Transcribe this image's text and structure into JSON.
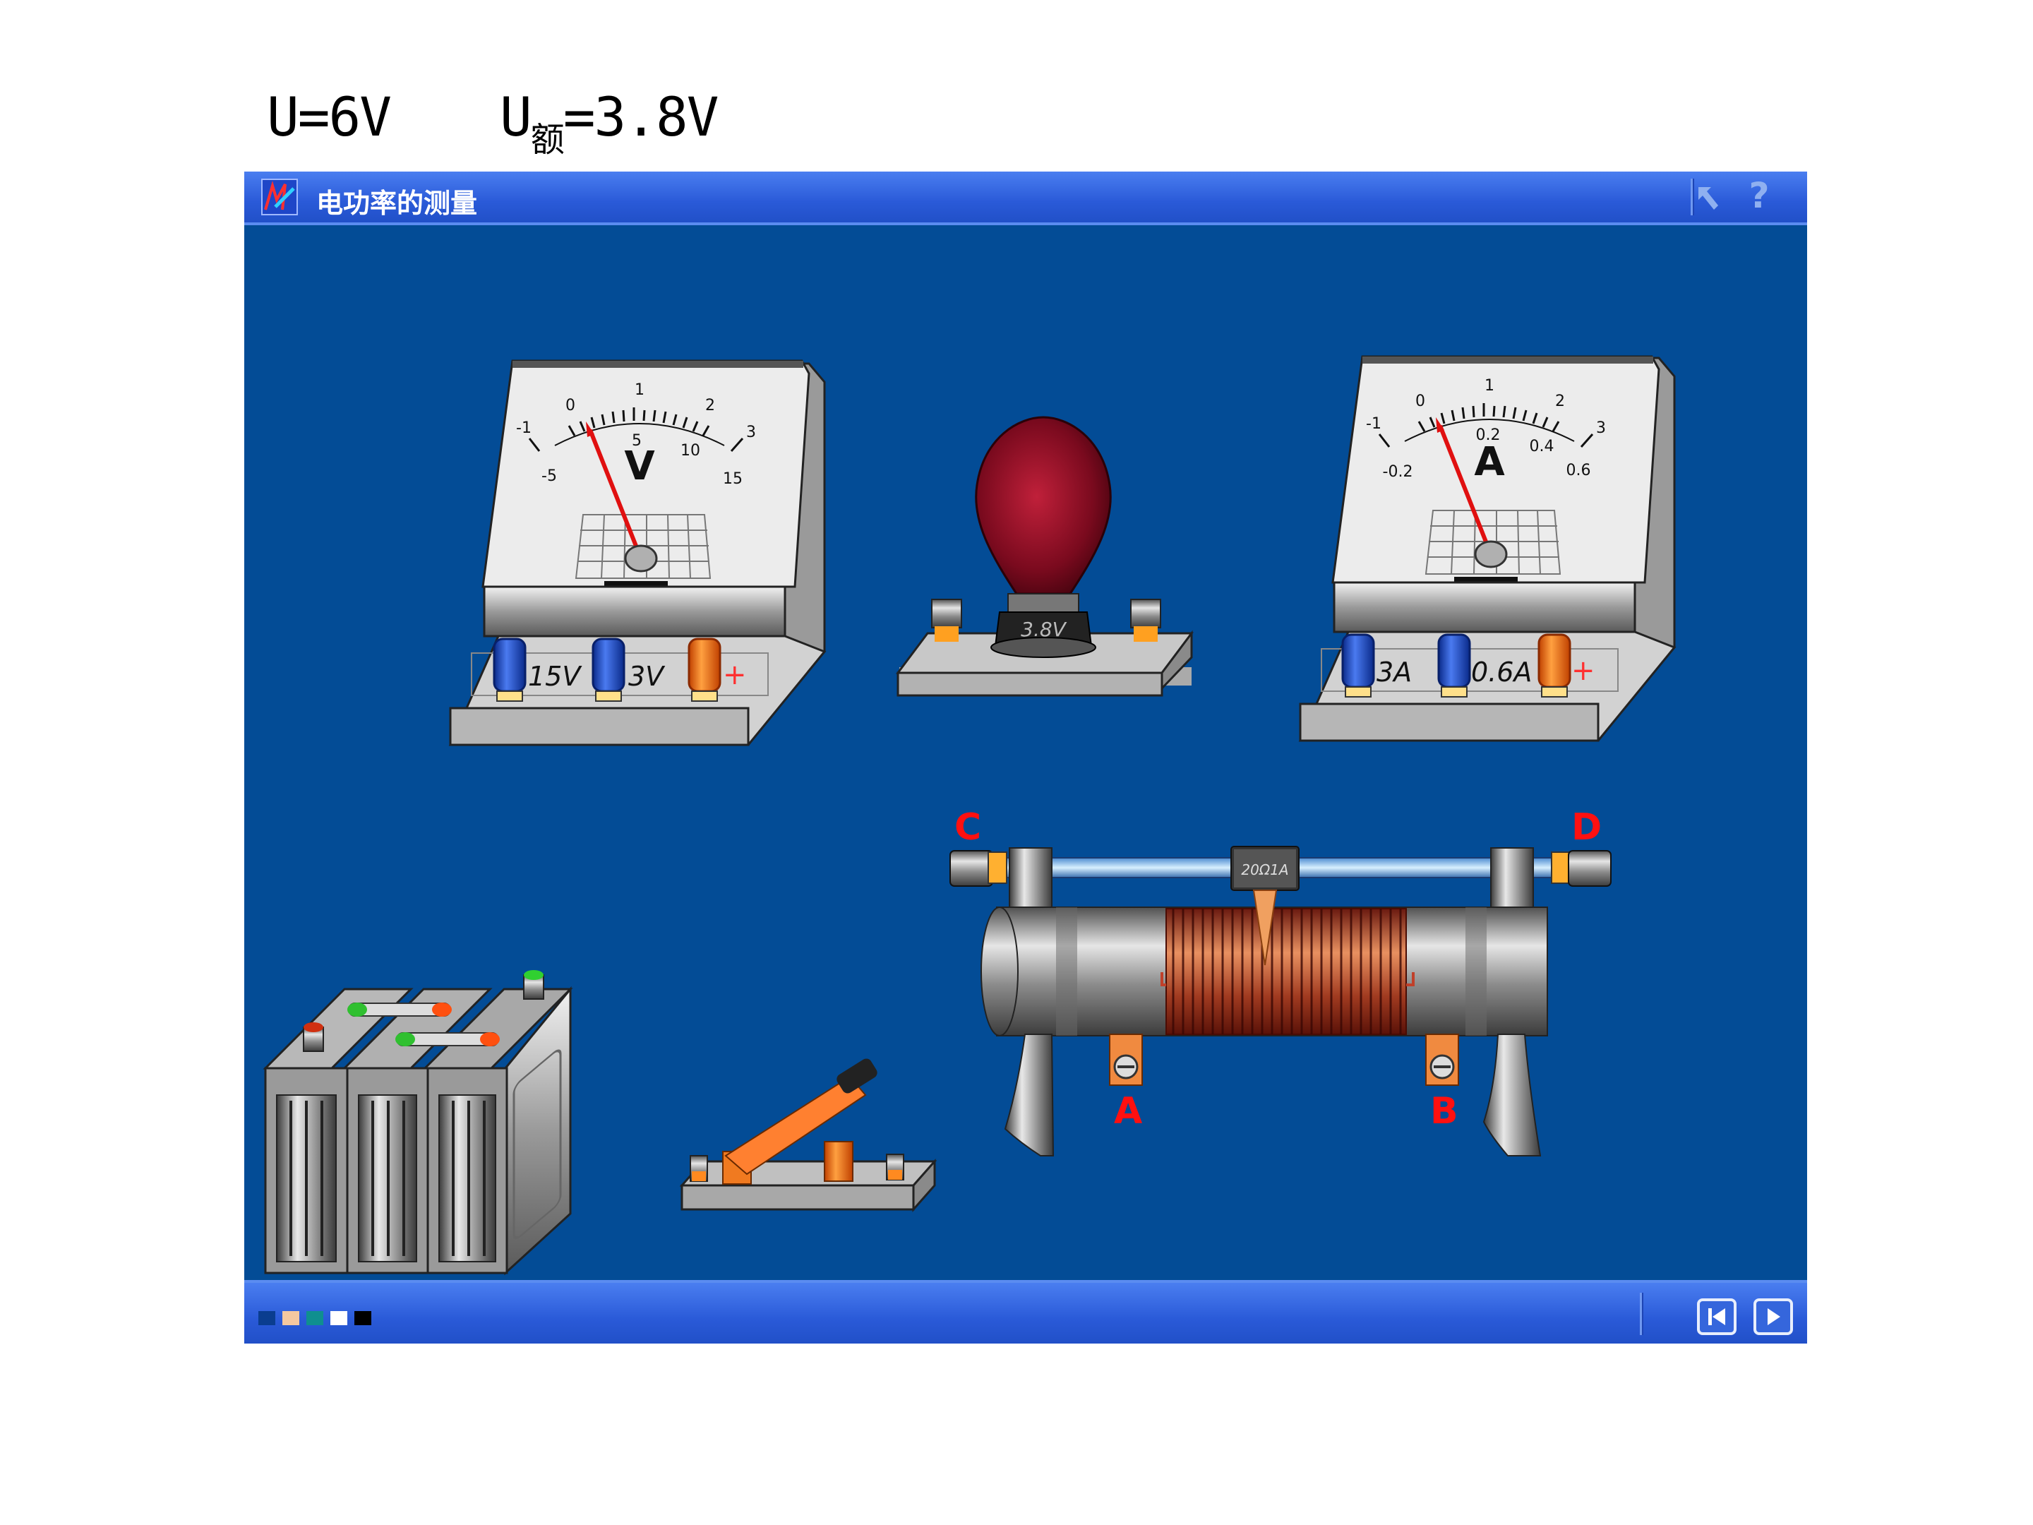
{
  "header": {
    "supply_voltage": "U=6V",
    "rated_voltage_prefix": "U",
    "rated_voltage_sub": "额",
    "rated_voltage_value": "=3.8V"
  },
  "window": {
    "title": "电功率的测量",
    "help_label": "?"
  },
  "voltmeter": {
    "unit_symbol": "V",
    "scale_top": [
      "0",
      "1",
      "2",
      "3"
    ],
    "scale_bottom": [
      "0",
      "5",
      "10",
      "15"
    ],
    "scale_neg_top": "-1",
    "scale_neg_bottom": "-5",
    "terminals": [
      "15V",
      "3V",
      "+"
    ],
    "terminal_colors": [
      "#1f4fc8",
      "#1f4fc8",
      "#ff6a00"
    ]
  },
  "ammeter": {
    "unit_symbol": "A",
    "scale_top": [
      "0",
      "1",
      "2",
      "3"
    ],
    "scale_bottom": [
      "0.2",
      "0.4",
      "0.6"
    ],
    "scale_neg_top": "-1",
    "scale_neg_bottom": "-0.2",
    "terminals": [
      "3A",
      "0.6A",
      "+"
    ],
    "terminal_colors": [
      "#1f4fc8",
      "#1f4fc8",
      "#ff6a00"
    ]
  },
  "bulb": {
    "rating": "3.8V"
  },
  "rheostat": {
    "slider_label": "20Ω1A",
    "terminal_c": "C",
    "terminal_d": "D",
    "terminal_a": "A",
    "terminal_b": "B"
  },
  "palette": [
    "#0a3d8f",
    "#f4c8a0",
    "#0f8f8f",
    "#ffffff",
    "#000000"
  ],
  "colors": {
    "background": "#034c96",
    "titlebar": "#2a5ad8",
    "terminal_label": "#ff0000",
    "needle": "#e01010"
  },
  "icons": {
    "app": "app-logo-icon",
    "pointer": "pointer-arrow-icon",
    "help": "help-icon",
    "prev": "skip-back-icon",
    "next": "play-next-icon"
  }
}
